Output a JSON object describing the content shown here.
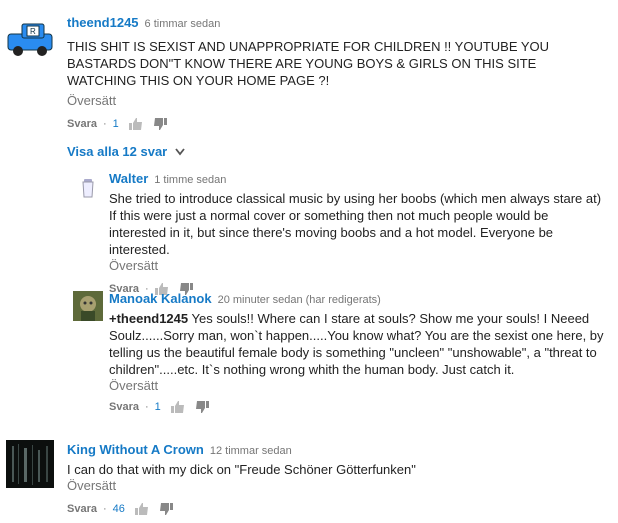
{
  "comments": [
    {
      "author": "theend1245",
      "time": "6 timmar sedan",
      "text": "THIS SHIT IS SEXIST AND UNAPPROPRIATE FOR CHILDREN !! YOUTUBE YOU BASTARDS DON\"T KNOW THERE ARE YOUNG BOYS & GIRLS ON THIS SITE WATCHING THIS ON YOUR HOME PAGE  ?!",
      "translate": "Översätt",
      "reply": "Svara",
      "likes": "1"
    },
    {
      "author": "King Without A Crown",
      "time": "12 timmar sedan",
      "text": "I can do that with my dick on \"Freude Schöner Götterfunken\"",
      "translate": "Översätt",
      "reply": "Svara",
      "likes": "46"
    }
  ],
  "view_all_replies": "Visa alla 12 svar",
  "replies": [
    {
      "author": "Walter",
      "time": "1 timme sedan",
      "text": "She tried to introduce classical music by using her boobs (which men always stare at) If this were just a normal cover or something then not much people would be interested in it, but since there's moving boobs and a hot model. Everyone be interested.",
      "translate": "Översätt",
      "reply": "Svara"
    },
    {
      "author": "Manoak Kalanok",
      "time": "20 minuter sedan (har redigerats)",
      "mention": "+theend1245",
      "text": " Yes souls!! Where can I stare at souls? Show me your souls! I Neeed Soulz......Sorry man, won`t happen.....You know what? You are the sexist one here, by telling us the beautiful female body is something \"uncleen\" \"unshowable\", a \"threat to children\".....etc. It`s nothing wrong whith the human body. Just catch it.",
      "translate": "Översätt",
      "reply": "Svara",
      "likes": "1"
    }
  ],
  "separator": "·",
  "colors": {
    "link": "#167ac6",
    "meta": "#767676",
    "text": "#222222"
  }
}
